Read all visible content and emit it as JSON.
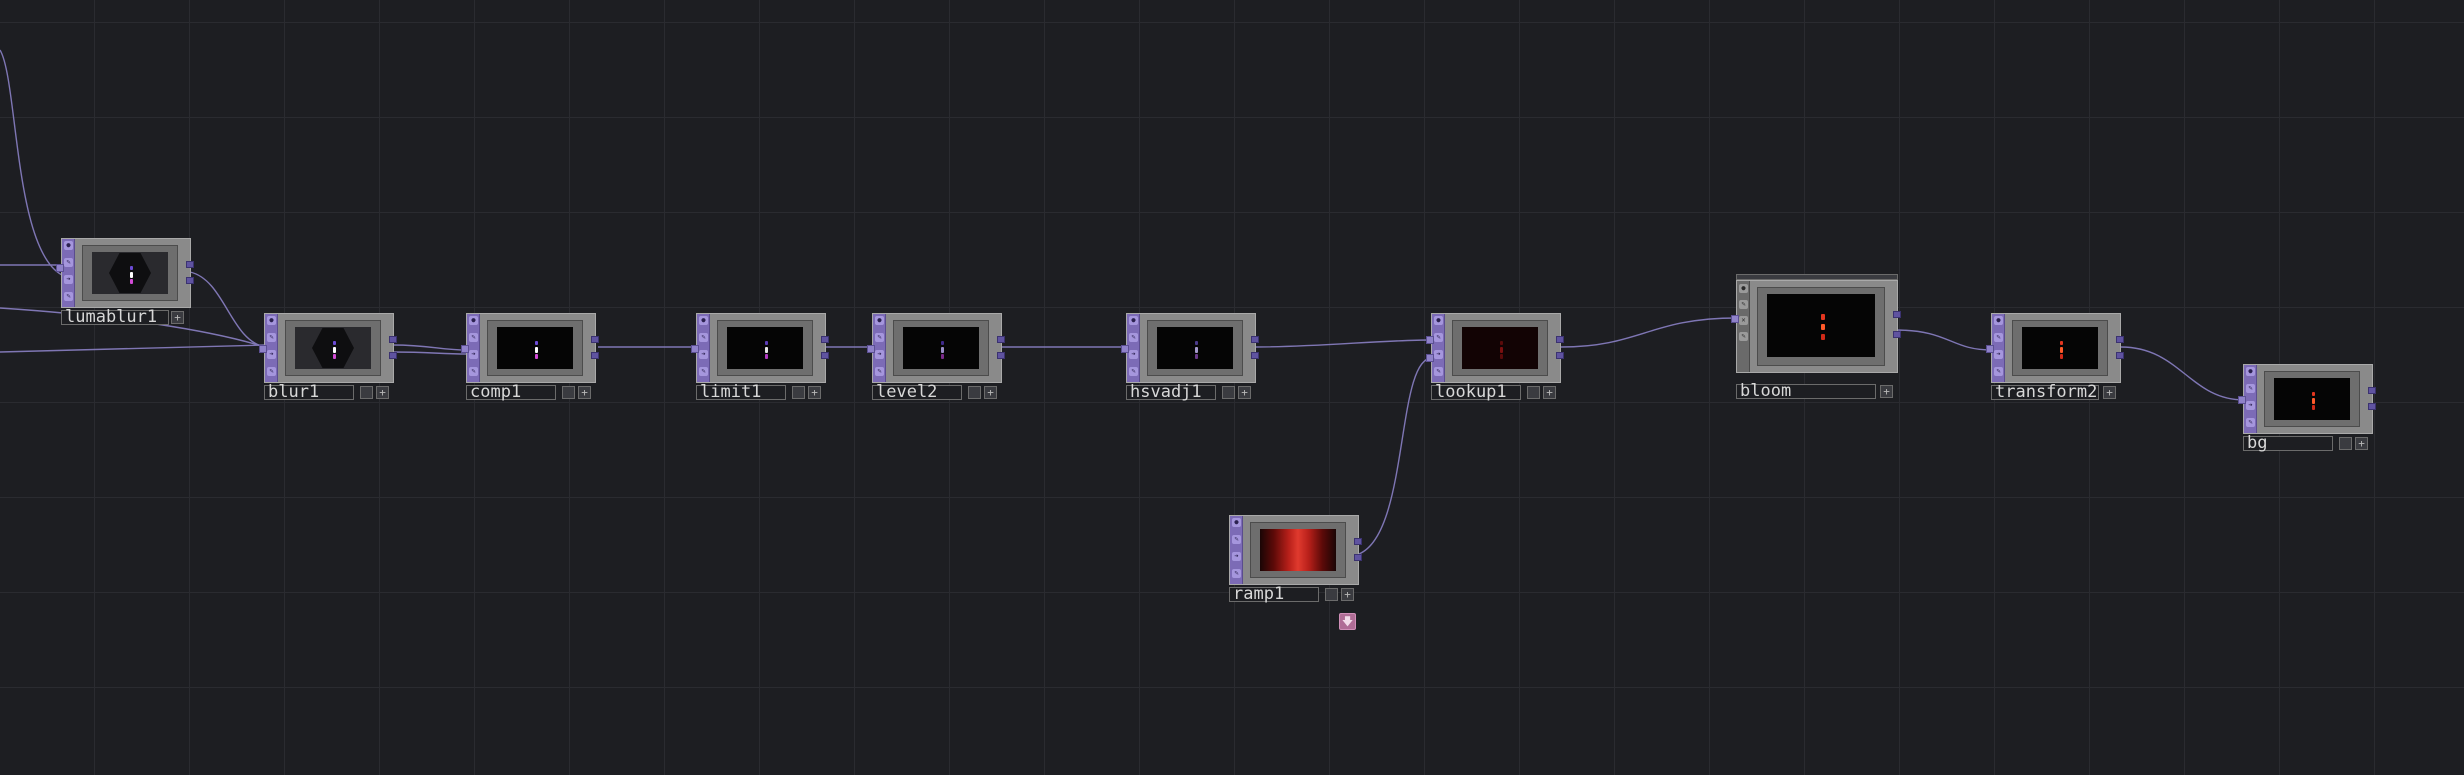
{
  "network": {
    "nodes": [
      {
        "id": "lumablur1",
        "label": "lumablur1",
        "preview": "particle-hex"
      },
      {
        "id": "blur1",
        "label": "blur1",
        "preview": "particle-hex"
      },
      {
        "id": "comp1",
        "label": "comp1",
        "preview": "particle-colored"
      },
      {
        "id": "limit1",
        "label": "limit1",
        "preview": "particle-colored"
      },
      {
        "id": "level2",
        "label": "level2",
        "preview": "particle-dim"
      },
      {
        "id": "hsvadj1",
        "label": "hsvadj1",
        "preview": "particle-dim"
      },
      {
        "id": "lookup1",
        "label": "lookup1",
        "preview": "particle-red-dim"
      },
      {
        "id": "bloom",
        "label": "bloom",
        "preview": "particle-red"
      },
      {
        "id": "transform2",
        "label": "transform2",
        "preview": "particle-red"
      },
      {
        "id": "bg",
        "label": "bg",
        "preview": "particle-red"
      },
      {
        "id": "ramp1",
        "label": "ramp1",
        "preview": "red-ramp"
      }
    ],
    "connections": [
      [
        "lumablur1",
        "blur1"
      ],
      [
        "blur1",
        "comp1"
      ],
      [
        "comp1",
        "limit1"
      ],
      [
        "limit1",
        "level2"
      ],
      [
        "level2",
        "hsvadj1"
      ],
      [
        "hsvadj1",
        "lookup1"
      ],
      [
        "ramp1",
        "lookup1"
      ],
      [
        "lookup1",
        "bloom"
      ],
      [
        "bloom",
        "transform2"
      ],
      [
        "transform2",
        "bg"
      ]
    ],
    "icons": {
      "flag": "flag-icon",
      "viewer": "viewer-icon",
      "bypass": "bypass-icon",
      "display": "display-icon",
      "add": "plus-icon",
      "down": "down-arrow-icon"
    },
    "colors": {
      "background": "#1d1e22",
      "grid": "#2a2b30",
      "strip": "#7c6bb6",
      "wire": "#8a80c4",
      "node_body": "#8a8a8a",
      "ramp_accent": "#e03a2e",
      "down_flag": "#b06d96"
    }
  }
}
